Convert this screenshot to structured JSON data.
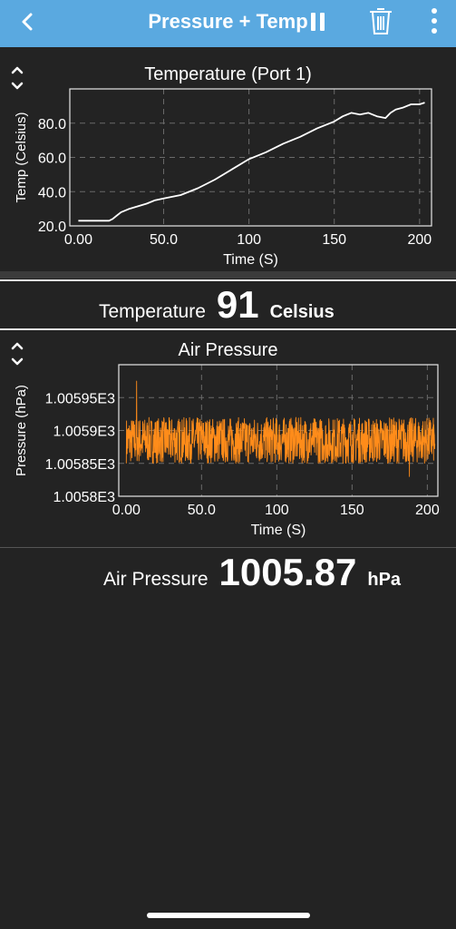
{
  "header": {
    "title": "Pressure + Temp",
    "back_icon": "chevron-left-icon",
    "pause_icon": "pause-icon",
    "delete_icon": "trash-icon",
    "menu_icon": "more-vertical-icon",
    "bar_color": "#5aa9e0"
  },
  "temperature_chart": {
    "title": "Temperature (Port 1)",
    "reorder_icon": "reorder-arrows-icon"
  },
  "temperature_readout": {
    "label": "Temperature",
    "value": "91",
    "unit": "Celsius"
  },
  "pressure_chart": {
    "title": "Air Pressure",
    "reorder_icon": "reorder-arrows-icon"
  },
  "pressure_readout": {
    "label": "Air Pressure",
    "value": "1005.87",
    "unit": "hPa"
  },
  "chart_data": [
    {
      "type": "line",
      "title": "Temperature (Port 1)",
      "xlabel": "Time (S)",
      "ylabel": "Temp (Celsius)",
      "xlim": [
        -5,
        207
      ],
      "ylim": [
        20,
        100
      ],
      "xticks": [
        0,
        50,
        100,
        150,
        200
      ],
      "xtick_labels": [
        "0.00",
        "50.0",
        "100",
        "150",
        "200"
      ],
      "yticks": [
        20,
        40,
        60,
        80
      ],
      "ytick_labels": [
        "20.0",
        "40.0",
        "60.0",
        "80.0"
      ],
      "grid": true,
      "line_color": "#ffffff",
      "series": [
        {
          "x": [
            0,
            10,
            18,
            20,
            25,
            30,
            40,
            45,
            50,
            55,
            60,
            70,
            80,
            90,
            100,
            110,
            120,
            130,
            140,
            150,
            155,
            160,
            165,
            170,
            175,
            180,
            183,
            186,
            190,
            195,
            200,
            203
          ],
          "y": [
            23,
            23,
            23,
            24,
            28,
            30,
            33,
            35,
            36,
            37,
            38,
            42,
            47,
            53,
            59,
            63,
            68,
            72,
            77,
            81,
            84,
            86,
            85,
            86,
            84,
            83,
            86,
            88,
            89,
            91,
            91,
            92
          ]
        }
      ]
    },
    {
      "type": "line",
      "title": "Air Pressure",
      "xlabel": "Time (S)",
      "ylabel": "Pressure (hPa)",
      "xlim": [
        -5,
        207
      ],
      "ylim": [
        1005.8,
        1006.0
      ],
      "xticks": [
        0,
        50,
        100,
        150,
        200
      ],
      "xtick_labels": [
        "0.00",
        "50.0",
        "100",
        "150",
        "200"
      ],
      "yticks": [
        1005.8,
        1005.85,
        1005.9,
        1005.95
      ],
      "ytick_labels": [
        "1.0058E3",
        "1.00585E3",
        "1.0059E3",
        "1.00595E3"
      ],
      "grid": true,
      "line_color": "#ff8c1a",
      "series": [
        {
          "name": "",
          "mean": 1005.885,
          "noise_amplitude": 0.035,
          "max": 1005.975,
          "min": 1005.83,
          "sample_count": 1200,
          "x_range": [
            0,
            205
          ]
        }
      ]
    }
  ]
}
